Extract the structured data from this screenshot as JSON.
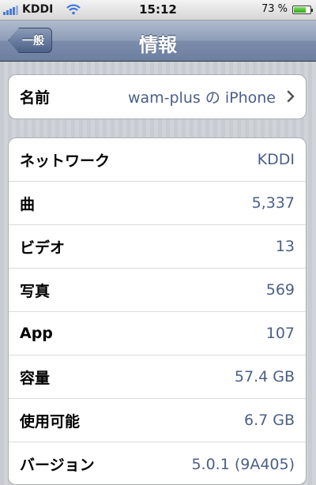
{
  "status_bar": {
    "carrier": "KDDI",
    "time": "15:12",
    "battery_percent": "73 %",
    "battery_level": 0.73,
    "signal_icon": "signal-icon",
    "wifi_icon": "wifi-icon",
    "battery_icon": "battery-icon"
  },
  "nav": {
    "back_label": "一般",
    "title": "情報"
  },
  "name_row": {
    "label": "名前",
    "value": "wam-plus の iPhone",
    "icon": "chevron-right-icon"
  },
  "info_rows": [
    {
      "label": "ネットワーク",
      "value": "KDDI"
    },
    {
      "label": "曲",
      "value": "5,337"
    },
    {
      "label": "ビデオ",
      "value": "13"
    },
    {
      "label": "写真",
      "value": "569"
    },
    {
      "label": "App",
      "value": "107"
    },
    {
      "label": "容量",
      "value": "57.4 GB"
    },
    {
      "label": "使用可能",
      "value": "6.7 GB"
    },
    {
      "label": "バージョン",
      "value": "5.0.1 (9A405)"
    }
  ],
  "colors": {
    "value_text": "#4b5f87",
    "nav_bar": "#8d9db7",
    "background": "#c8ccd2"
  }
}
